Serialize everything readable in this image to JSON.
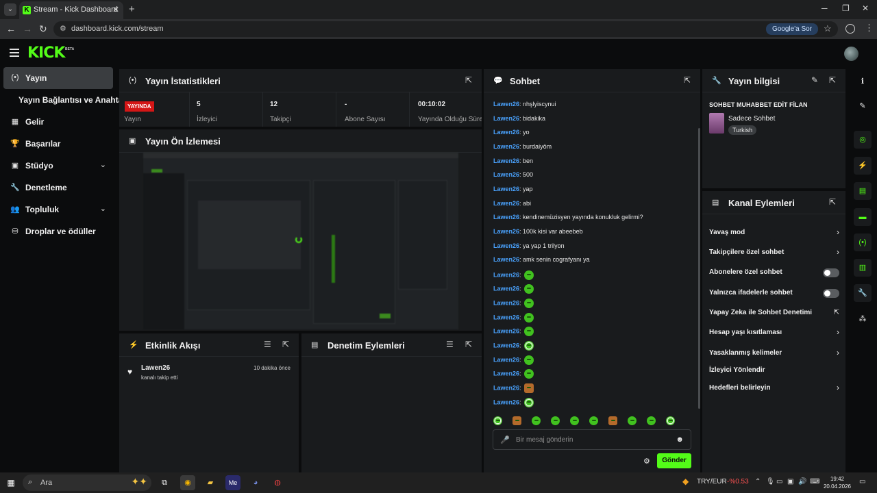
{
  "browser": {
    "tab_title": "Stream - Kick Dashboard",
    "tab_favicon": "K",
    "url": "dashboard.kick.com/stream",
    "google_chip": "Google'a Sor"
  },
  "app": {
    "logo": "KICK",
    "logo_badge": "BETA",
    "accent": "#53fc18"
  },
  "sidebar": {
    "items": [
      {
        "label": "Yayın",
        "icon": "broadcast-icon"
      },
      {
        "label": "Yayın Bağlantısı ve Anahtarı"
      },
      {
        "label": "Gelir",
        "icon": "revenue-icon"
      },
      {
        "label": "Başarılar",
        "icon": "trophy-icon"
      },
      {
        "label": "Stüdyo",
        "icon": "studio-icon"
      },
      {
        "label": "Denetleme",
        "icon": "wrench-icon"
      },
      {
        "label": "Topluluk",
        "icon": "community-icon"
      },
      {
        "label": "Droplar ve ödüller",
        "icon": "drops-icon"
      }
    ]
  },
  "stats": {
    "title": "Yayın İstatistikleri",
    "live_badge": "YAYINDA",
    "cells": [
      {
        "value": "",
        "label": "Yayın"
      },
      {
        "value": "5",
        "label": "İzleyici"
      },
      {
        "value": "12",
        "label": "Takipçi"
      },
      {
        "value": "-",
        "label": "Abone Sayısı"
      },
      {
        "value": "00:10:02",
        "label": "Yayında Olduğu Süre"
      }
    ]
  },
  "preview": {
    "title": "Yayın Ön İzlemesi"
  },
  "activity": {
    "title": "Etkinlik Akışı",
    "events": [
      {
        "user": "Lawen26",
        "action": "kanalı takip etti",
        "time": "10 dakika önce"
      }
    ]
  },
  "moderation": {
    "title": "Denetim Eylemleri"
  },
  "chat": {
    "title": "Sohbet",
    "messages": [
      {
        "user": "Lawen26",
        "text": "nhşlyiscynui"
      },
      {
        "user": "Lawen26",
        "text": "bidakika"
      },
      {
        "user": "Lawen26",
        "text": "yo"
      },
      {
        "user": "Lawen26",
        "text": "burdaiyöm"
      },
      {
        "user": "Lawen26",
        "text": "ben"
      },
      {
        "user": "Lawen26",
        "text": "500"
      },
      {
        "user": "Lawen26",
        "text": "yap"
      },
      {
        "user": "Lawen26",
        "text": "abi"
      },
      {
        "user": "Lawen26",
        "text": "kendinemüzisyen yayında konukluk gelirmi?"
      },
      {
        "user": "Lawen26",
        "text": "100k kisi var abeebeb"
      },
      {
        "user": "Lawen26",
        "text": "ya yap 1 trilyon"
      },
      {
        "user": "Lawen26",
        "text": "amk senin cografyanı ya"
      },
      {
        "user": "Lawen26",
        "text": "",
        "emote": "green"
      },
      {
        "user": "Lawen26",
        "text": "",
        "emote": "green"
      },
      {
        "user": "Lawen26",
        "text": "",
        "emote": "green"
      },
      {
        "user": "Lawen26",
        "text": "",
        "emote": "green"
      },
      {
        "user": "Lawen26",
        "text": "",
        "emote": "green"
      },
      {
        "user": "Lawen26",
        "text": "",
        "emote": "mixed"
      },
      {
        "user": "Lawen26",
        "text": "",
        "emote": "green"
      },
      {
        "user": "Lawen26",
        "text": "",
        "emote": "green"
      },
      {
        "user": "Lawen26",
        "text": "",
        "emote": "brown"
      },
      {
        "user": "Lawen26",
        "text": "",
        "emote": "mixed"
      }
    ],
    "input_placeholder": "Bir mesaj gönderin",
    "send_label": "Gönder"
  },
  "stream_info": {
    "title": "Yayın bilgisi",
    "stream_title": "SOHBET MUHABBET EDİT FİLAN",
    "category": "Sadece Sohbet",
    "tag": "Turkish"
  },
  "channel_actions": {
    "title": "Kanal Eylemleri",
    "items": [
      {
        "label": "Yavaş mod",
        "control": "chevron"
      },
      {
        "label": "Takipçilere özel sohbet",
        "control": "chevron"
      },
      {
        "label": "Abonelere özel sohbet",
        "control": "toggle"
      },
      {
        "label": "Yalnızca ifadelerle sohbet",
        "control": "toggle"
      },
      {
        "label": "Yapay Zeka ile Sohbet Denetimi",
        "control": "external"
      },
      {
        "label": "Hesap yaşı kısıtlaması",
        "control": "chevron"
      },
      {
        "label": "Yasaklanmış kelimeler",
        "control": "chevron"
      },
      {
        "label": "İzleyici Yönlendir",
        "control": "none"
      },
      {
        "label": "Hedefleri belirleyin",
        "control": "chevron"
      }
    ]
  },
  "taskbar": {
    "search": "Ara",
    "currency": "TRY/EUR",
    "currency_change": "-%0.53",
    "time": "19:42",
    "date": "20.04.2026"
  }
}
